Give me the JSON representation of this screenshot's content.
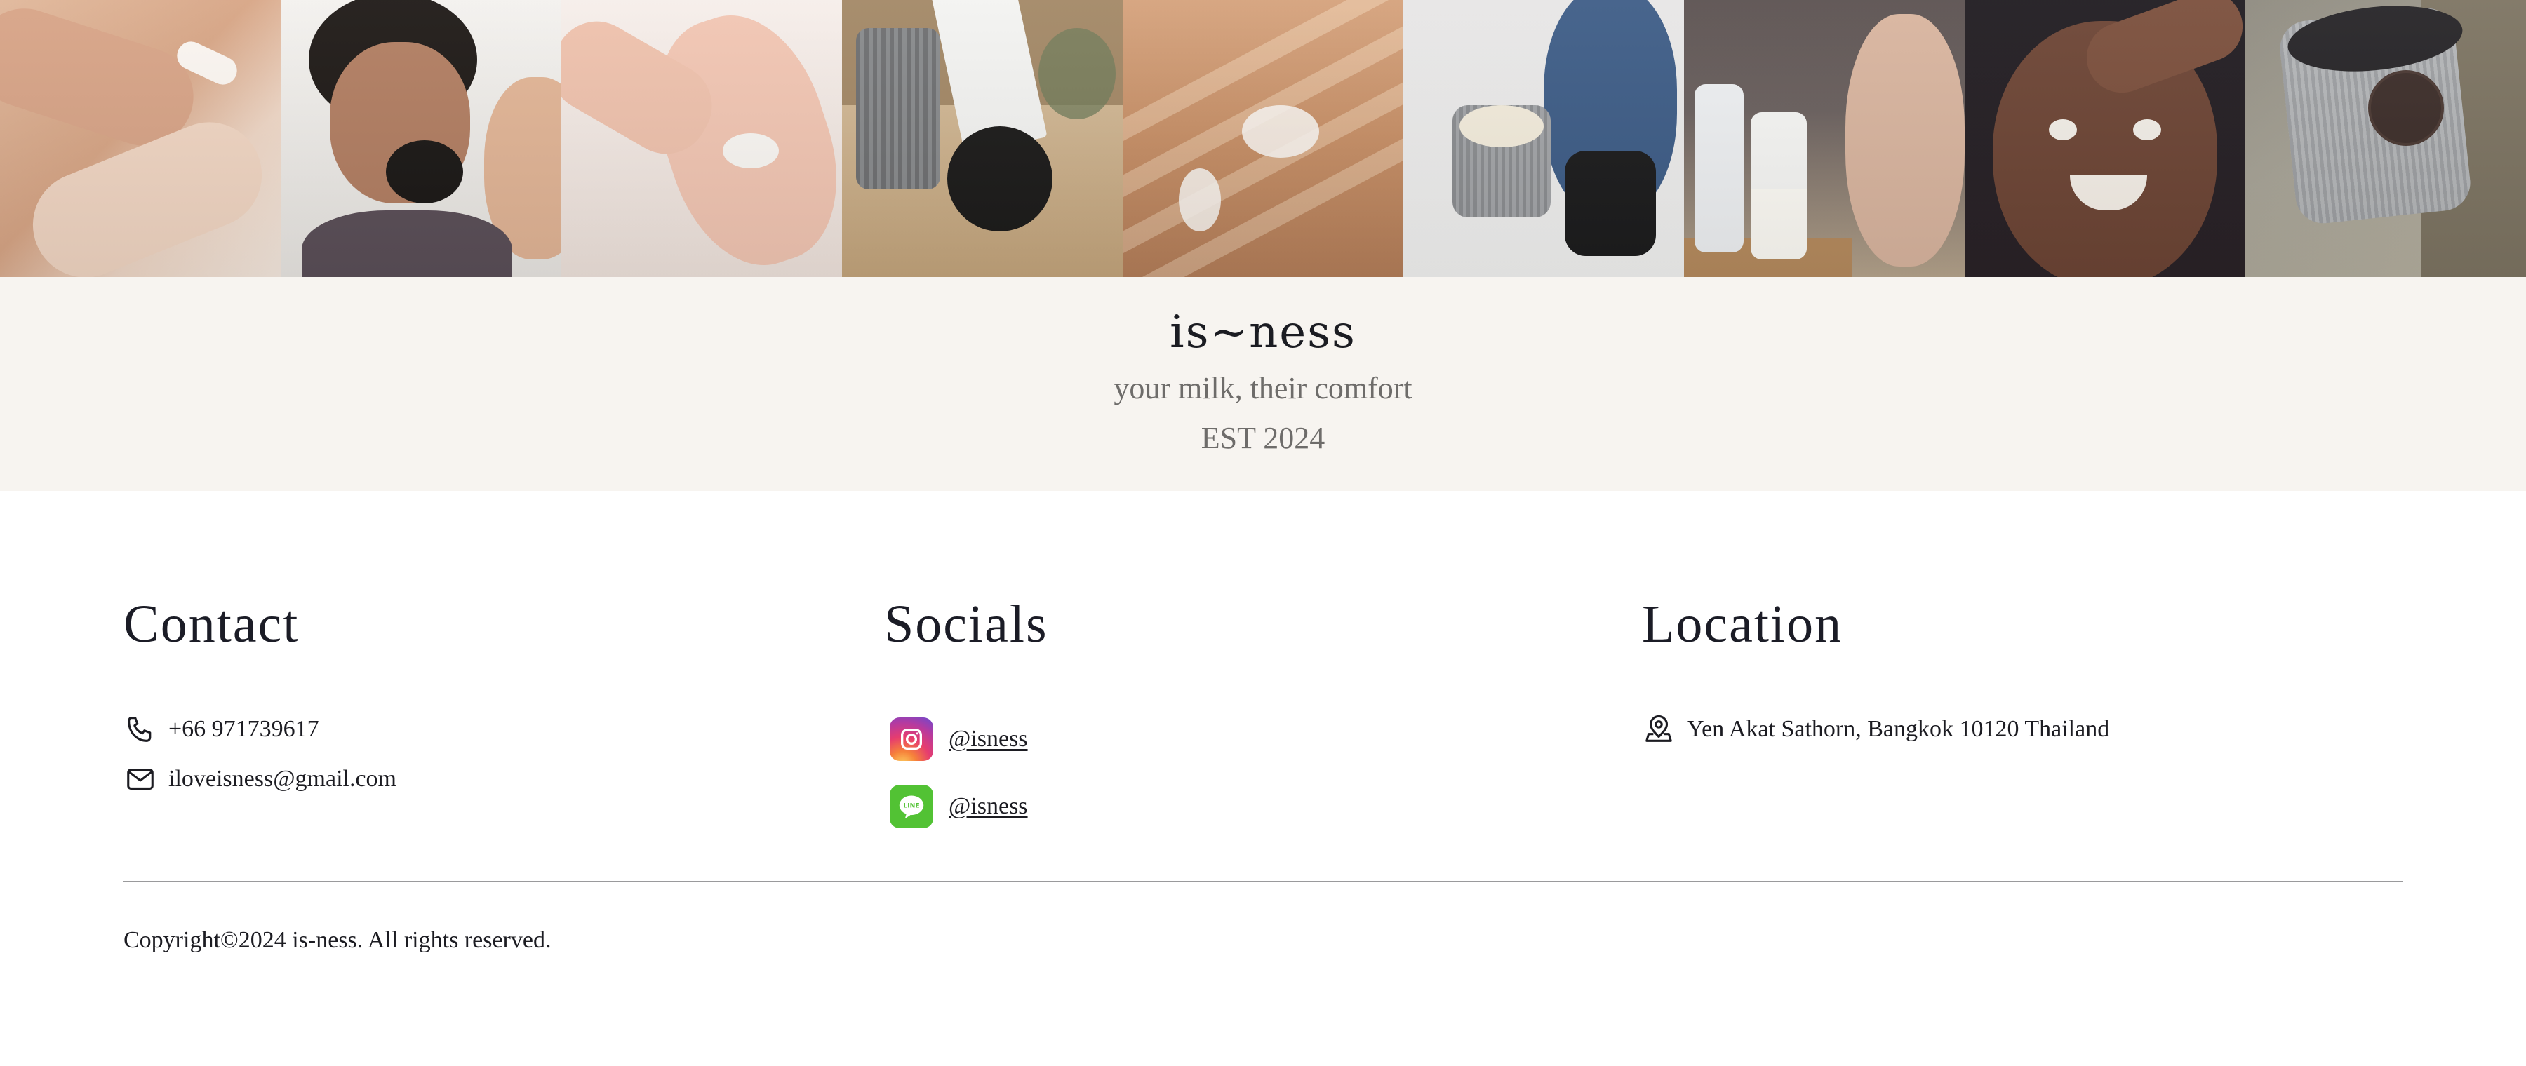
{
  "gallery": {
    "photos": [
      {
        "name": "lotion-hands-photo"
      },
      {
        "name": "child-with-jar-photo"
      },
      {
        "name": "foot-balm-photo"
      },
      {
        "name": "packaging-photo"
      },
      {
        "name": "back-cream-photo"
      },
      {
        "name": "plush-and-jars-photo"
      },
      {
        "name": "breast-pump-photo"
      },
      {
        "name": "smiling-child-photo"
      },
      {
        "name": "jar-on-rock-photo"
      }
    ]
  },
  "brand": {
    "title": "is~ness",
    "tagline": "your milk, their comfort",
    "est": "EST 2024"
  },
  "footer": {
    "contact": {
      "heading": "Contact",
      "phone": "+66 971739617",
      "email": "iloveisness@gmail.com",
      "phone_icon": "phone-icon",
      "email_icon": "mail-icon"
    },
    "socials": {
      "heading": "Socials",
      "instagram": {
        "handle": "@isness",
        "icon": "instagram-icon"
      },
      "line": {
        "handle": "@isness",
        "icon": "line-icon",
        "icon_text": "LINE"
      }
    },
    "location": {
      "heading": "Location",
      "address": "Yen Akat Sathorn, Bangkok 10120 Thailand",
      "icon": "map-pin-icon"
    },
    "copyright": "Copyright©2024 is-ness. All rights reserved."
  },
  "colors": {
    "band_background": "#f7f4f0",
    "heading_text": "#1b1c26",
    "muted_text": "#6e6c6a",
    "divider": "#9a9a9c",
    "line_green": "#52c234"
  }
}
